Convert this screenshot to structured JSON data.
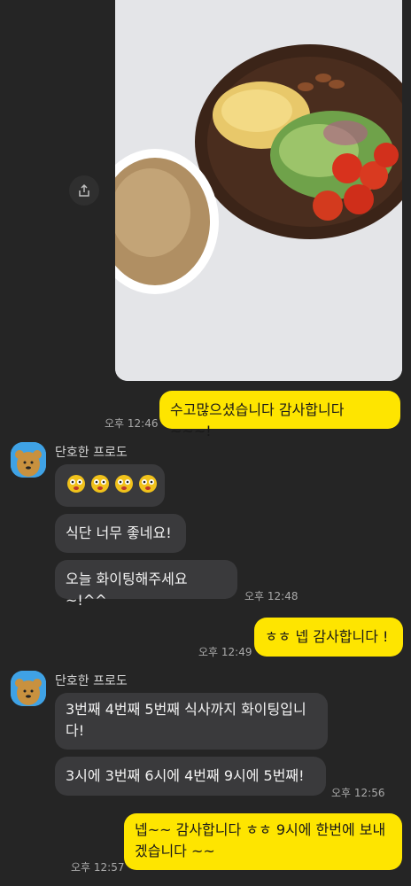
{
  "photo_share": {
    "icon": "share-icon"
  },
  "messages": {
    "m1": {
      "text": "수고많으셨습니다 감사합니다 ~~~!",
      "time": "오후 12:46"
    },
    "sender1": {
      "name": "단호한 프로도"
    },
    "emoji_group": {
      "icon": "frodo-emoticon"
    },
    "m2": {
      "text": "식단 너무 좋네요!"
    },
    "m3": {
      "text": "오늘 화이팅해주세요~!^^",
      "time": "오후 12:48"
    },
    "m4": {
      "text": "ㅎㅎ 넵 감사합니다 !",
      "time": "오후 12:49"
    },
    "sender2": {
      "name": "단호한 프로도"
    },
    "m5": {
      "line1": "3번째 4번째 5번째 식사까지 화이팅입니",
      "line2": "다!"
    },
    "m6": {
      "text": "3시에 3번째 6시에 4번째 9시에 5번째!",
      "time": "오후 12:56"
    },
    "m7": {
      "line1": "넵~~ 감사합니다 ㅎㅎ 9시에 한번에 보내",
      "line2": "겠습니다 ~~",
      "time": "오후 12:57"
    }
  },
  "colors": {
    "background": "#252525",
    "my_bubble": "#fee500",
    "their_bubble": "#3a3a3c",
    "avatar_bg": "#3fa2e5"
  }
}
